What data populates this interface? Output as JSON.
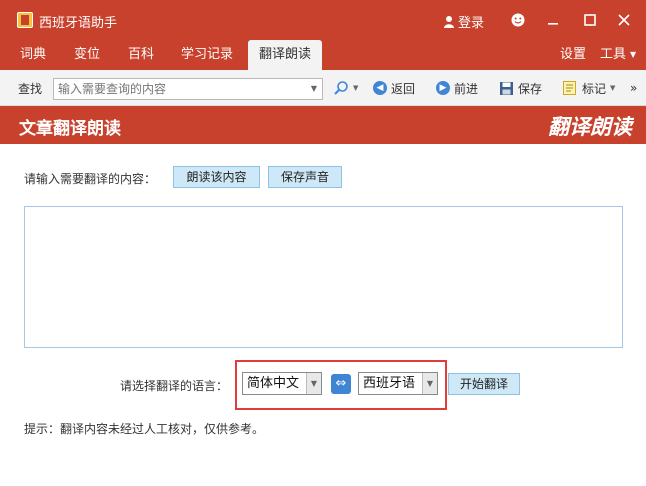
{
  "titlebar": {
    "app_title": "西班牙语助手",
    "login_label": "登录",
    "icons": [
      "app-logo-icon",
      "user-icon",
      "smiley-icon",
      "minimize-icon",
      "maximize-icon",
      "close-icon"
    ]
  },
  "menubar": {
    "tabs": [
      {
        "label": "词典"
      },
      {
        "label": "变位"
      },
      {
        "label": "百科"
      },
      {
        "label": "学习记录"
      },
      {
        "label": "翻译朗读"
      }
    ],
    "active_tab": "翻译朗读",
    "settings_label": "设置",
    "tools_label": "工具"
  },
  "toolbar": {
    "search_label": "查找",
    "search_placeholder": "输入需要查询的内容",
    "back_label": "返回",
    "forward_label": "前进",
    "save_label": "保存",
    "mark_label": "标记"
  },
  "header": {
    "title": "文章翻译朗读",
    "brand": "翻译朗读"
  },
  "main": {
    "prompt": "请输入需要翻译的内容：",
    "read_button": "朗读该内容",
    "save_sound_button": "保存声音",
    "lang_label": "请选择翻译的语言：",
    "source_lang": "简体中文",
    "target_lang": "西班牙语",
    "swap_symbol": "⇔",
    "start_button": "开始翻译",
    "hint": "提示：翻译内容未经过人工核对，仅供参考。"
  },
  "colors": {
    "brand_red": "#c8412c",
    "button_blue": "#cfe8f7",
    "highlight_red": "#e23b3b",
    "swap_blue": "#3e85d4"
  }
}
